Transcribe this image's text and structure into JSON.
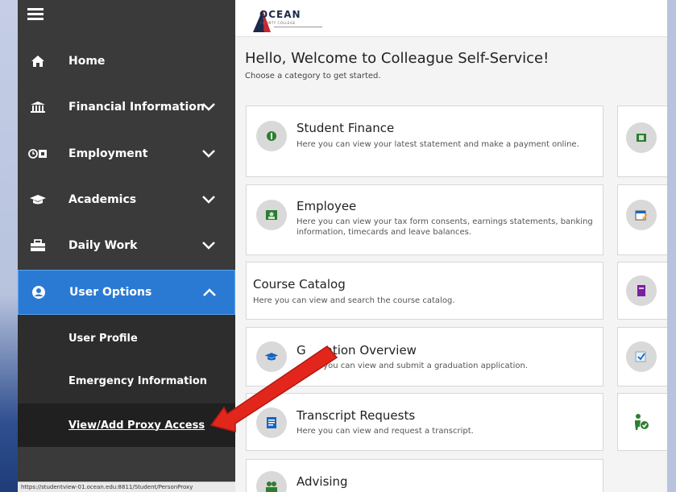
{
  "browser": {
    "status_url": "https://studentview-01.ocean.edu:8811/Student/PersonProxy"
  },
  "sidebar": {
    "items": [
      {
        "label": "Home",
        "icon": "home-icon"
      },
      {
        "label": "Financial Information",
        "icon": "bank-icon"
      },
      {
        "label": "Employment",
        "icon": "clock-money-icon"
      },
      {
        "label": "Academics",
        "icon": "graduation-cap-icon"
      },
      {
        "label": "Daily Work",
        "icon": "toolbox-icon"
      },
      {
        "label": "User Options",
        "icon": "user-circle-icon"
      }
    ],
    "sub_items": [
      {
        "label": "User Profile"
      },
      {
        "label": "Emergency Information"
      },
      {
        "label": "View/Add Proxy Access"
      }
    ]
  },
  "header": {
    "logo_text": "OCEAN",
    "logo_sub": "COUNTY COLLEGE"
  },
  "main": {
    "welcome_title": "Hello, Welcome to Colleague Self-Service!",
    "welcome_subtitle": "Choose a category to get started.",
    "cards": [
      {
        "title": "Student Finance",
        "desc": "Here you can view your latest statement and make a payment online.",
        "icon": "money-icon"
      },
      {
        "title": "Employee",
        "desc": "Here you can view your tax form consents, earnings statements, banking information, timecards and leave balances.",
        "icon": "id-badge-icon"
      },
      {
        "title": "Course Catalog",
        "desc": "Here you can view and search the course catalog."
      },
      {
        "title": "Graduation Overview",
        "title_visible": "G",
        "title_visible_2": "ation Overview",
        "desc": "Here you can view and submit a graduation application.",
        "desc_visible": "re you can view and submit a graduation application.",
        "icon": "graduation-cap-icon"
      },
      {
        "title": "Transcript Requests",
        "desc": "Here you can view and request a transcript.",
        "icon": "document-icon"
      },
      {
        "title": "Advising",
        "icon": "people-icon"
      }
    ]
  },
  "colors": {
    "sidebar_bg": "#3a3a3a",
    "active_blue": "#2a7ad4",
    "arrow_red": "#e3261c"
  }
}
